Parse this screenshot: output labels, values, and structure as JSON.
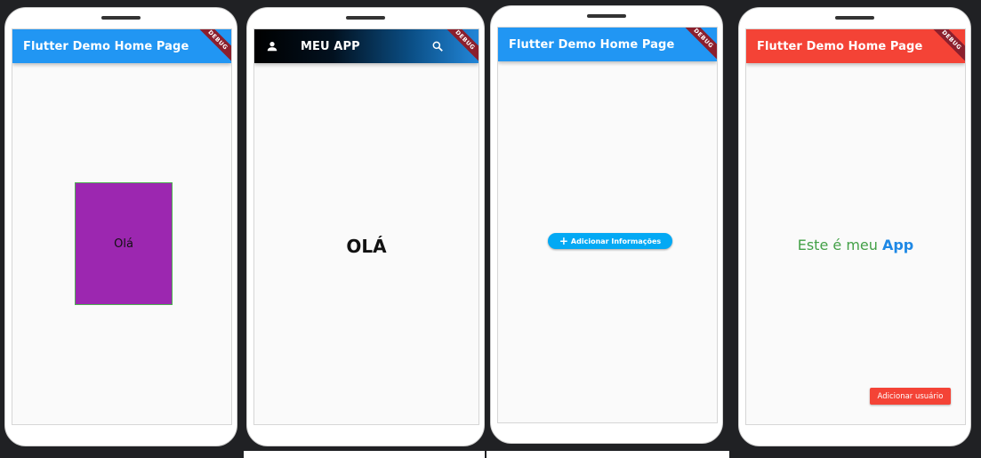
{
  "phones": [
    {
      "appbar": {
        "title": "Flutter Demo Home Page",
        "color": "#2196f3"
      },
      "debug_banner": "DEBUG",
      "body": {
        "box_text": "Olá",
        "box_color": "#9c27b0",
        "box_border": "#4caf50"
      }
    },
    {
      "appbar": {
        "title": "MEU APP",
        "leading_icon": "person-icon",
        "action_icon": "search-icon"
      },
      "debug_banner": "DEBUG",
      "body": {
        "text": "OLÁ"
      }
    },
    {
      "appbar": {
        "title": "Flutter Demo Home Page",
        "color": "#2196f3"
      },
      "debug_banner": "DEBUG",
      "body": {
        "button_label": "Adicionar Informações",
        "button_icon": "plus-icon",
        "button_color": "#03a9f4"
      }
    },
    {
      "appbar": {
        "title": "Flutter Demo Home Page",
        "color": "#f44336"
      },
      "debug_banner": "DEBUG",
      "body": {
        "rich_text_part1": "Este é meu ",
        "rich_text_part2": "App",
        "part1_color": "#43a047",
        "part2_color": "#1e88e5",
        "button_label": "Adicionar usuário",
        "button_color": "#f44336"
      }
    }
  ]
}
